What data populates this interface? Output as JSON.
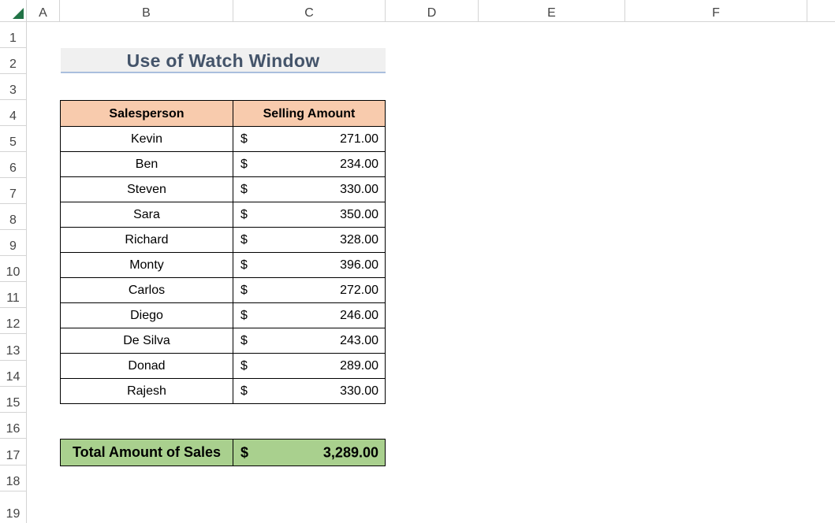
{
  "columns": [
    "A",
    "B",
    "C",
    "D",
    "E",
    "F"
  ],
  "rows": [
    "1",
    "2",
    "3",
    "4",
    "5",
    "6",
    "7",
    "8",
    "9",
    "10",
    "11",
    "12",
    "13",
    "14",
    "15",
    "16",
    "17",
    "18",
    "19"
  ],
  "title": "Use of Watch Window",
  "table": {
    "headers": {
      "name": "Salesperson",
      "amount": "Selling Amount"
    },
    "currency": "$",
    "rows": [
      {
        "name": "Kevin",
        "amount": "271.00"
      },
      {
        "name": "Ben",
        "amount": "234.00"
      },
      {
        "name": "Steven",
        "amount": "330.00"
      },
      {
        "name": "Sara",
        "amount": "350.00"
      },
      {
        "name": "Richard",
        "amount": "328.00"
      },
      {
        "name": "Monty",
        "amount": "396.00"
      },
      {
        "name": "Carlos",
        "amount": "272.00"
      },
      {
        "name": "Diego",
        "amount": "246.00"
      },
      {
        "name": "De Silva",
        "amount": "243.00"
      },
      {
        "name": "Donad",
        "amount": "289.00"
      },
      {
        "name": "Rajesh",
        "amount": "330.00"
      }
    ]
  },
  "total": {
    "label": "Total Amount of Sales",
    "currency": "$",
    "amount": "3,289.00"
  },
  "colors": {
    "header_fill": "#f8cbad",
    "total_fill": "#a9d08e",
    "title_color": "#44546a",
    "grid": "#d4d4d4"
  }
}
